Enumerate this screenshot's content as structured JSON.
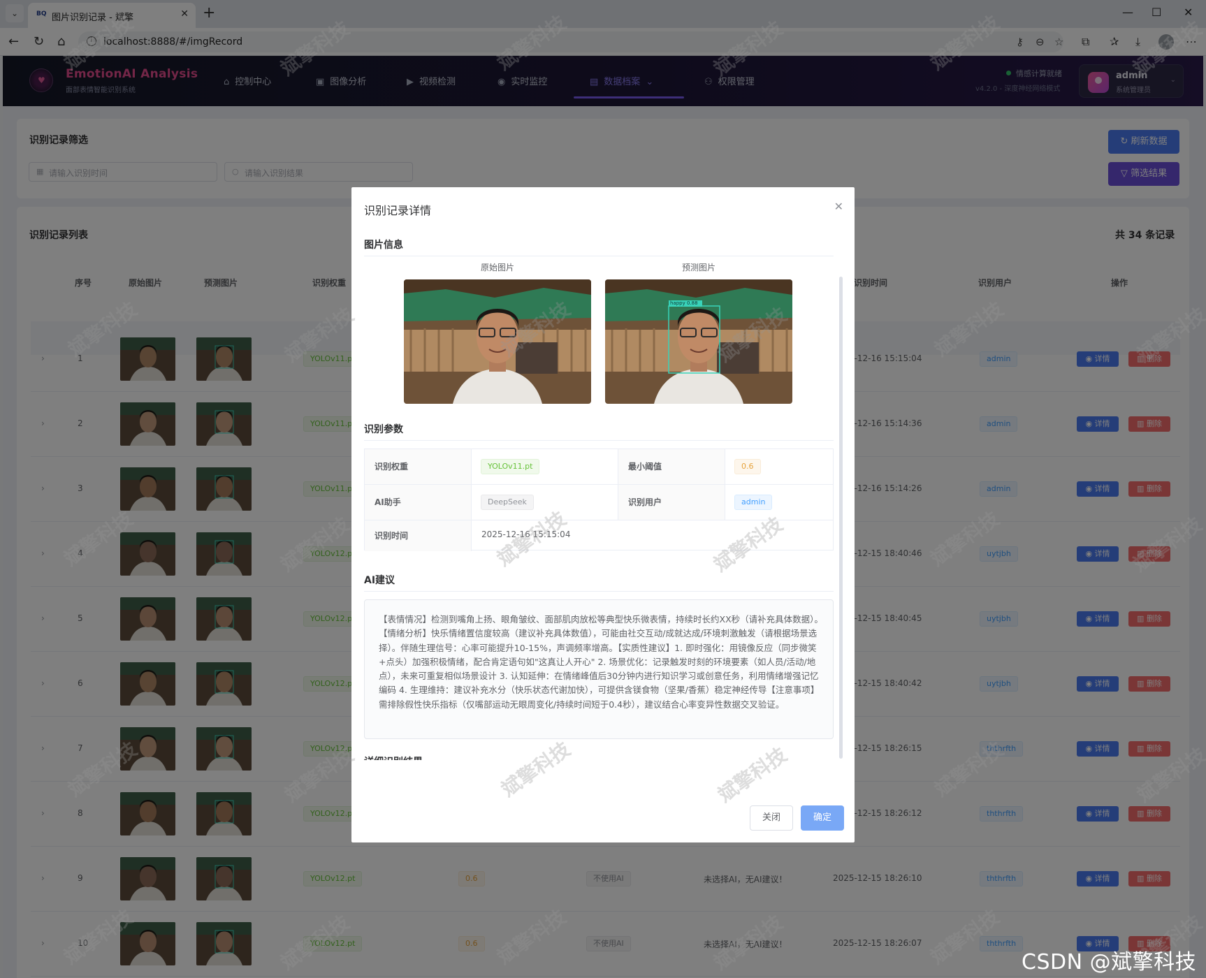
{
  "browser": {
    "tab_title": "图片识别记录 - 斌擎",
    "tab_favicon": "BQ",
    "url": "localhost:8888/#/imgRecord"
  },
  "app": {
    "logo_title": "EmotionAI Analysis",
    "logo_subtitle": "面部表情智能识别系统",
    "nav": [
      {
        "label": "控制中心",
        "icon": "⌂"
      },
      {
        "label": "图像分析",
        "icon": "▣"
      },
      {
        "label": "视频检测",
        "icon": "▶"
      },
      {
        "label": "实时监控",
        "icon": "◉"
      },
      {
        "label": "数据档案",
        "icon": "▤",
        "active": true,
        "caret": "⌄"
      },
      {
        "label": "权限管理",
        "icon": "⚇"
      }
    ],
    "status_text": "情感计算就绪",
    "version_text": "v4.2.0 - 深度神经网络模式",
    "user": {
      "name": "admin",
      "role": "系统管理员"
    }
  },
  "filter": {
    "title": "识别记录筛选",
    "time_placeholder": "请输入识别时间",
    "result_placeholder": "请输入识别结果",
    "refresh_label": "刷新数据",
    "filter_label": "筛选结果"
  },
  "list": {
    "title": "识别记录列表",
    "count_text": "共 34 条记录",
    "headers": [
      "序号",
      "原始图片",
      "预测图片",
      "识别权重",
      "识别时间",
      "识别用户",
      "操作"
    ],
    "detail_label": "详情",
    "delete_label": "删除",
    "rows": [
      {
        "no": "1",
        "weight": "YOLOv11.pt",
        "time": "2025-12-16 15:15:04",
        "user": "admin"
      },
      {
        "no": "2",
        "weight": "YOLOv11.pt",
        "time": "2025-12-16 15:14:36",
        "user": "admin"
      },
      {
        "no": "3",
        "weight": "YOLOv11.pt",
        "time": "2025-12-16 15:14:26",
        "user": "admin"
      },
      {
        "no": "4",
        "weight": "YOLOv12.pt",
        "time": "2025-12-15 18:40:46",
        "user": "uytjbh"
      },
      {
        "no": "5",
        "weight": "YOLOv12.pt",
        "time": "2025-12-15 18:40:45",
        "user": "uytjbh"
      },
      {
        "no": "6",
        "weight": "YOLOv12.pt",
        "time": "2025-12-15 18:40:42",
        "user": "uytjbh"
      },
      {
        "no": "7",
        "weight": "YOLOv12.pt",
        "time": "2025-12-15 18:26:15",
        "user": "ththrfth"
      },
      {
        "no": "8",
        "weight": "YOLOv12.pt",
        "time": "2025-12-15 18:26:12",
        "user": "ththrfth"
      },
      {
        "no": "9",
        "weight": "YOLOv12.pt",
        "conf": "0.6",
        "ai": "不使用AI",
        "ai_text": "未选择AI，无AI建议！",
        "time": "2025-12-15 18:26:10",
        "user": "ththrfth"
      },
      {
        "no": "10",
        "weight": "YOLOv12.pt",
        "conf": "0.6",
        "ai": "不使用AI",
        "ai_text": "未选择AI，无AI建议！",
        "time": "2025-12-15 18:26:07",
        "user": "ththrfth"
      }
    ]
  },
  "dialog": {
    "title": "识别记录详情",
    "image_section": "图片信息",
    "original_caption": "原始图片",
    "predicted_caption": "预测图片",
    "box_label": "happy 0.88",
    "params_section": "识别参数",
    "params": {
      "weight_label": "识别权重",
      "weight_value": "YOLOv11.pt",
      "conf_label": "最小阈值",
      "conf_value": "0.6",
      "ai_label": "AI助手",
      "ai_value": "DeepSeek",
      "user_label": "识别用户",
      "user_value": "admin",
      "time_label": "识别时间",
      "time_value": "2025-12-16 15:15:04"
    },
    "ai_section": "AI建议",
    "ai_advice": "【表情情况】检测到嘴角上扬、眼角皱纹、面部肌肉放松等典型快乐微表情，持续时长约XX秒（请补充具体数据）。【情绪分析】快乐情绪置信度较高（建议补充具体数值），可能由社交互动/成就达成/环境刺激触发（请根据场景选择）。伴随生理信号：心率可能提升10-15%，声调频率增高。【实质性建议】1. 即时强化：用镜像反应（同步微笑+点头）加强积极情绪，配合肯定语句如\"这真让人开心\" 2. 场景优化：记录触发时刻的环境要素（如人员/活动/地点），未来可重复相似场景设计 3. 认知延伸：在情绪峰值后30分钟内进行知识学习或创意任务，利用情绪增强记忆编码 4. 生理维持：建议补充水分（快乐状态代谢加快），可提供含镁食物（坚果/香蕉）稳定神经传导【注意事项】需排除假性快乐指标（仅嘴部运动无眼周变化/持续时间短于0.4秒），建议结合心率变异性数据交叉验证。",
    "detail_section": "详细识别结果",
    "close_label": "关闭",
    "confirm_label": "确定"
  },
  "watermark_text": "斌擎科技",
  "credit": "CSDN @斌擎科技",
  "colors": {
    "accent_blue": "#4a7af0",
    "accent_purple": "#6a4fd8",
    "danger": "#f56c6c",
    "logo_pink": "#e64c8f"
  }
}
